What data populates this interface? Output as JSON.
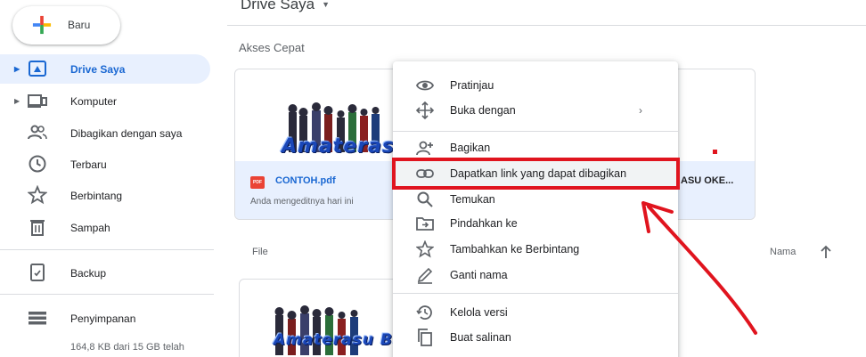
{
  "sidebar": {
    "new_label": "Baru",
    "items": [
      {
        "label": "Drive Saya",
        "icon": "drive-icon",
        "active": true,
        "caret": true
      },
      {
        "label": "Komputer",
        "icon": "computer-icon",
        "active": false,
        "caret": true
      },
      {
        "label": "Dibagikan dengan saya",
        "icon": "shared-people-icon",
        "active": false,
        "caret": false
      },
      {
        "label": "Terbaru",
        "icon": "clock-icon",
        "active": false,
        "caret": false
      },
      {
        "label": "Berbintang",
        "icon": "star-icon",
        "active": false,
        "caret": false
      },
      {
        "label": "Sampah",
        "icon": "trash-icon",
        "active": false,
        "caret": false
      },
      {
        "label": "Backup",
        "icon": "backup-icon",
        "active": false,
        "caret": false
      },
      {
        "label": "Penyimpanan",
        "icon": "storage-icon",
        "active": false,
        "caret": false
      }
    ],
    "storage_text": "164,8 KB dari 15 GB telah"
  },
  "main": {
    "title": "Drive Saya",
    "quick_access_title": "Akses Cepat",
    "quick_card": {
      "file_name": "CONTOH.pdf",
      "file_type_badge": "PDF",
      "subtitle": "Anda mengeditnya hari ini",
      "second_file_name": "ASU OKE...",
      "thumbnail_text": "Amaterasu"
    },
    "files_header": {
      "file_label": "File",
      "name_label": "Nama"
    },
    "file_card": {
      "thumbnail_text": "Amaterasu Blo"
    }
  },
  "context_menu": {
    "items": [
      {
        "label": "Pratinjau",
        "icon": "eye-icon"
      },
      {
        "label": "Buka dengan",
        "icon": "open-with-icon",
        "has_submenu": true
      },
      {
        "label": "Bagikan",
        "icon": "share-person-add-icon"
      },
      {
        "label": "Dapatkan link yang dapat dibagikan",
        "icon": "link-icon",
        "highlighted": true
      },
      {
        "label": "Temukan",
        "icon": "search-icon"
      },
      {
        "label": "Pindahkan ke",
        "icon": "move-folder-icon"
      },
      {
        "label": "Tambahkan ke Berbintang",
        "icon": "star-outline-icon"
      },
      {
        "label": "Ganti nama",
        "icon": "pencil-icon"
      },
      {
        "label": "Kelola versi",
        "icon": "history-icon"
      },
      {
        "label": "Buat salinan",
        "icon": "copy-icon"
      }
    ],
    "submenu_arrow": "›"
  },
  "colors": {
    "accent": "#1967d2",
    "active_bg": "#e8f0fe",
    "annotation_red": "#e0141e"
  }
}
